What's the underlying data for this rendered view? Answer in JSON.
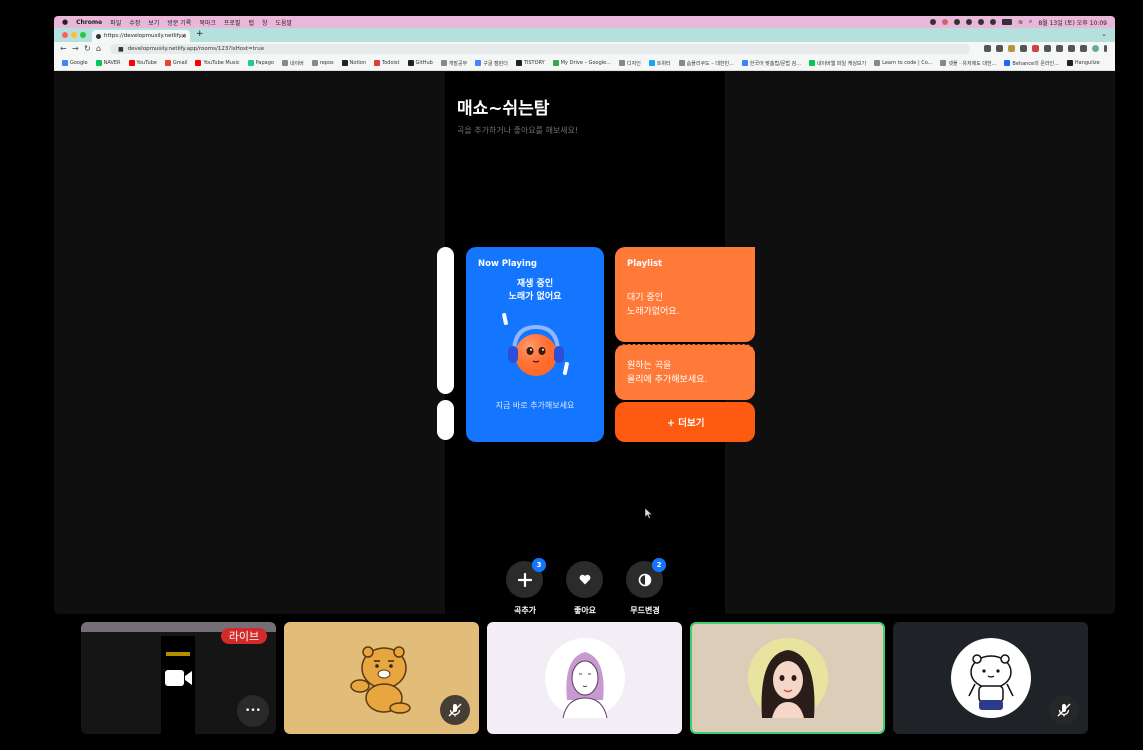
{
  "browser": {
    "menubar": {
      "apple": "",
      "app": "Chrome",
      "menus": [
        "파일",
        "수정",
        "보기",
        "방문 기록",
        "북마크",
        "프로필",
        "탭",
        "창",
        "도움말"
      ],
      "clock": "8월 13일 (토) 오후 10:09"
    },
    "tab": {
      "title": "https://developmusily.netlify.a",
      "close": "×",
      "new_tab": "+"
    },
    "address": {
      "url": "developmusily.netlify.app/rooms/123?isHost=true",
      "back": "←",
      "forward": "→",
      "reload": "↻",
      "home": "⌂"
    },
    "bookmarks": [
      {
        "label": "Google",
        "color": "#4285f4"
      },
      {
        "label": "NAVER",
        "color": "#03c75a"
      },
      {
        "label": "YouTube",
        "color": "#ff0000"
      },
      {
        "label": "Gmail",
        "color": "#ea4335"
      },
      {
        "label": "YouTube Music",
        "color": "#ff0000"
      },
      {
        "label": "Papago",
        "color": "#20c997"
      },
      {
        "label": "네이버",
        "color": "#888888"
      },
      {
        "label": "repos",
        "color": "#888888"
      },
      {
        "label": "Notion",
        "color": "#222222"
      },
      {
        "label": "Todoist",
        "color": "#db4035"
      },
      {
        "label": "GitHub",
        "color": "#222222"
      },
      {
        "label": "개발공부",
        "color": "#888888"
      },
      {
        "label": "구글 캘린더",
        "color": "#4285f4"
      },
      {
        "label": "TISTORY",
        "color": "#222222"
      },
      {
        "label": "My Drive – Google...",
        "color": "#34a853"
      },
      {
        "label": "디자인",
        "color": "#888888"
      },
      {
        "label": "트위터",
        "color": "#1da1f2"
      },
      {
        "label": "솜플리쿠도 – 대한민...",
        "color": "#888888"
      },
      {
        "label": "한국어 맞춤법/문법 검...",
        "color": "#3b82f6"
      },
      {
        "label": "네이버웹 파일 캐싱보기",
        "color": "#03c75a"
      },
      {
        "label": "Learn to code | Co...",
        "color": "#888888"
      },
      {
        "label": "넷플 · 유저에도 대한...",
        "color": "#888888"
      },
      {
        "label": "Behance의 온라인...",
        "color": "#1769ff"
      },
      {
        "label": "Hangulize",
        "color": "#222222"
      }
    ]
  },
  "app": {
    "room_title": "매쇼~쉬는탐",
    "subtitle": "곡을 추가하거나 좋아요를 해보세요!",
    "now_playing": {
      "label": "Now Playing",
      "empty_line1": "재생 중인",
      "empty_line2": "노래가 없어요",
      "hint": "지금 바로 추가해보세요",
      "color": "#1476ff"
    },
    "playlist": {
      "label": "Playlist",
      "wait_line1": "대기 중인",
      "wait_line2": "노래가없어요.",
      "want_line1": "원하는 곡을",
      "want_line2": "올리에 추가해보세요.",
      "more": "+ 더보기",
      "color": "#ff7a39"
    },
    "actions": [
      {
        "label": "곡추가",
        "badge": "3",
        "icon": "plus-icon"
      },
      {
        "label": "좋아요",
        "badge": "",
        "icon": "heart-icon"
      },
      {
        "label": "무드변경",
        "badge": "2",
        "icon": "mood-icon"
      }
    ]
  },
  "participants": [
    {
      "type": "screen-share",
      "live_label": "라이브",
      "more": "•••",
      "color": "#151515"
    },
    {
      "type": "avatar",
      "avatar": "ryan-character",
      "muted": true,
      "color": "#e2bd7a"
    },
    {
      "type": "avatar",
      "avatar": "woman-line-drawing",
      "muted": false,
      "color": "#f3eef5"
    },
    {
      "type": "avatar",
      "avatar": "woman-3d-portrait",
      "muted": false,
      "active_speaker": true,
      "color": "#dccdb9"
    },
    {
      "type": "avatar",
      "avatar": "hamster-drawing",
      "muted": true,
      "color": "#1f2328"
    }
  ]
}
